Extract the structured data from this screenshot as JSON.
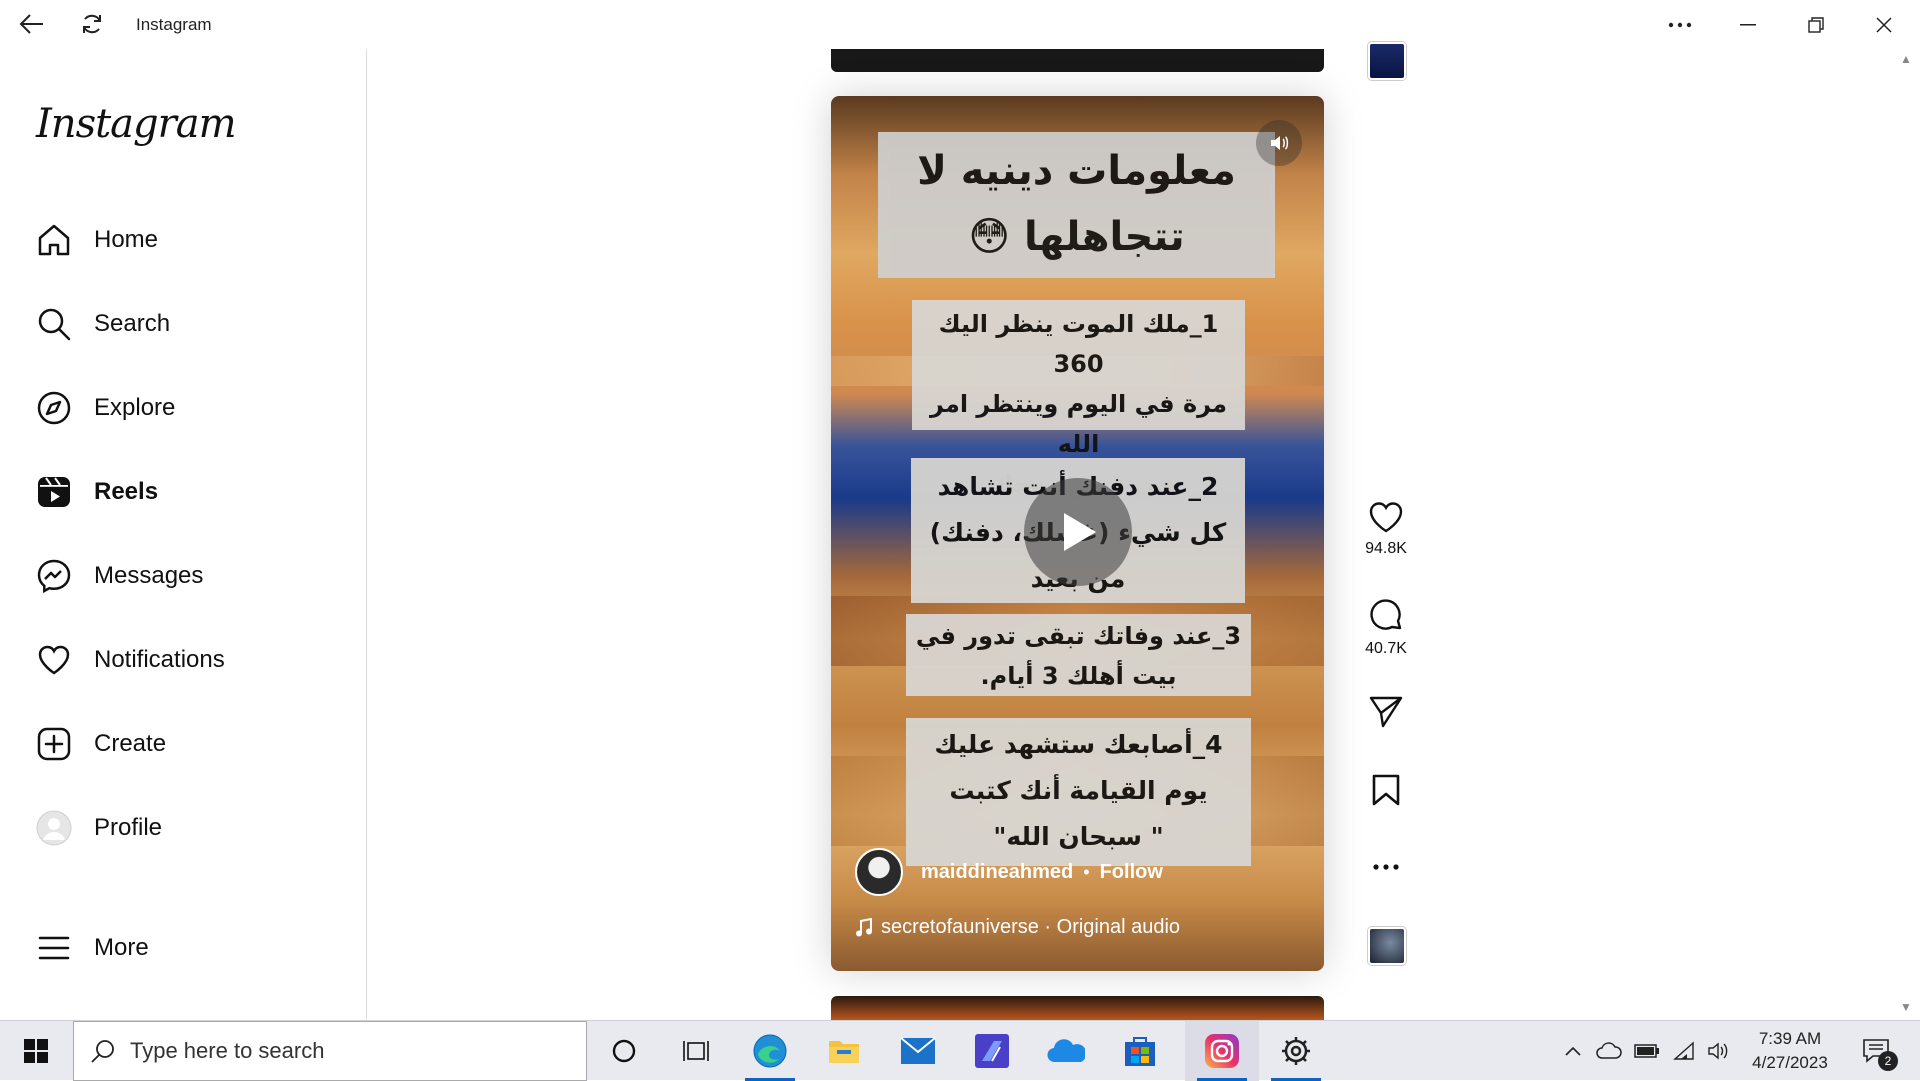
{
  "window": {
    "title": "Instagram",
    "controls": [
      "more-icon",
      "minimize-icon",
      "restore-icon",
      "close-icon"
    ]
  },
  "sidebar": {
    "logo": "Instagram",
    "items": [
      {
        "label": "Home",
        "icon": "home-icon"
      },
      {
        "label": "Search",
        "icon": "search-icon"
      },
      {
        "label": "Explore",
        "icon": "compass-icon"
      },
      {
        "label": "Reels",
        "icon": "reels-icon",
        "active": true
      },
      {
        "label": "Messages",
        "icon": "messenger-icon"
      },
      {
        "label": "Notifications",
        "icon": "heart-icon"
      },
      {
        "label": "Create",
        "icon": "plus-square-icon"
      },
      {
        "label": "Profile",
        "icon": "avatar"
      },
      {
        "label": "More",
        "icon": "hamburger-icon"
      }
    ]
  },
  "reel": {
    "title_text": "معلومات دينيه لا\nتتجاهلها 😳",
    "points": [
      "1_ملك الموت ينظر اليك 360\nمرة في اليوم وينتظر امر الله\nفي قبض روحك.",
      "2_عند دفنك أنت تشاهد\nكل شيء (غسلك، دفنك)\nمن بعيد",
      "3_عند وفاتك تبقى تدور في\nبيت أهلك 3 أيام.",
      "4_أصابعك ستشهد عليك\nيوم القيامة أنك كتبت\n\" سبحان الله\""
    ],
    "author": "maiddineahmed",
    "separator": "•",
    "follow_label": "Follow",
    "audio": "secretofauniverse · Original audio"
  },
  "actions": {
    "likes": "94.8K",
    "comments": "40.7K"
  },
  "taskbar": {
    "search_placeholder": "Type here to search",
    "apps": [
      "cortana-icon",
      "task-view-icon",
      "edge-icon",
      "file-explorer-icon",
      "mail-icon",
      "powerapps-icon",
      "onedrive-icon",
      "store-icon",
      "instagram-icon",
      "settings-icon"
    ],
    "time": "7:39 AM",
    "date": "4/27/2023",
    "notification_count": "2"
  },
  "colors": {
    "accent": "#0a64c8",
    "sidebar_border": "#dbdbdb",
    "taskbar_bg": "#e9e9f0"
  }
}
